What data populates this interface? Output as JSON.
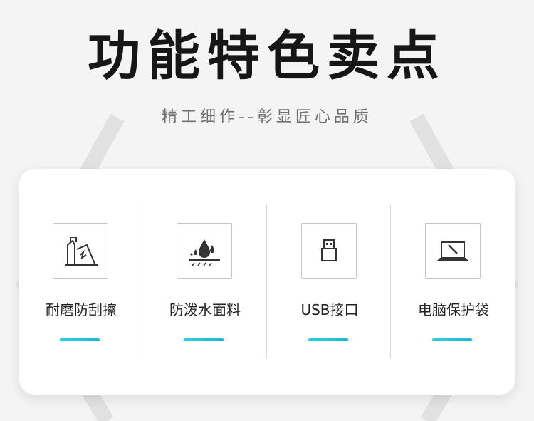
{
  "header": {
    "title": "功能特色卖点",
    "subtitle": "精工细作--彰显匠心品质"
  },
  "features": [
    {
      "label": "耐磨防刮擦",
      "icon": "scratch-resistant-icon"
    },
    {
      "label": "防泼水面料",
      "icon": "water-drop-icon"
    },
    {
      "label": "USB接口",
      "icon": "usb-connector-icon"
    },
    {
      "label": "电脑保护袋",
      "icon": "laptop-icon"
    }
  ],
  "colors": {
    "background": "#f4f4f4",
    "card": "#ffffff",
    "accent": "#22c4dc",
    "title": "#161616",
    "subtitle": "#6f6f6f"
  }
}
